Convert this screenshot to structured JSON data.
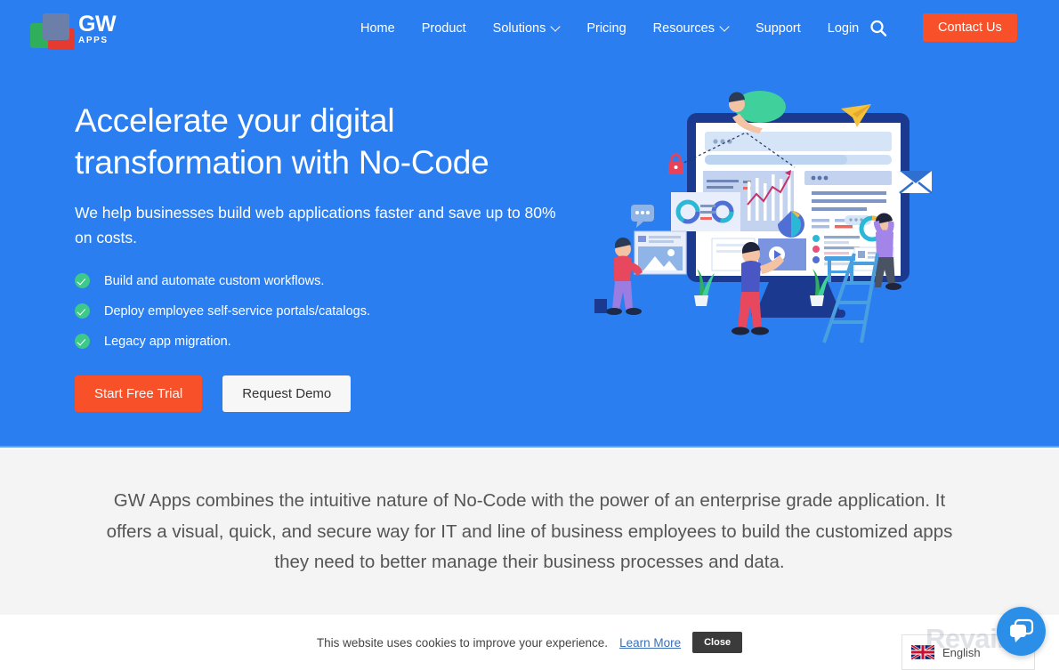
{
  "brand": {
    "logo_name": "GW",
    "logo_sub": "APPS",
    "colors": {
      "hero_blue": "#2b7ef0",
      "accent_orange": "#f8512a",
      "check_green": "#3dc98a",
      "logo_green": "#2fae5c",
      "logo_red": "#e43a30",
      "logo_blue": "#6b7fa8",
      "chat_blue": "#2b8fe8"
    }
  },
  "nav": {
    "items": [
      {
        "label": "Home",
        "has_dropdown": false
      },
      {
        "label": "Product",
        "has_dropdown": false
      },
      {
        "label": "Solutions",
        "has_dropdown": true
      },
      {
        "label": "Pricing",
        "has_dropdown": false
      },
      {
        "label": "Resources",
        "has_dropdown": true
      },
      {
        "label": "Support",
        "has_dropdown": false
      },
      {
        "label": "Login",
        "has_dropdown": false
      }
    ],
    "search_icon": "search-icon",
    "contact_label": "Contact Us"
  },
  "hero": {
    "title_line1": "Accelerate your digital",
    "title_line2": "transformation with No-Code",
    "subtitle": "We help businesses build web applications faster and save up to 80% on costs.",
    "bullets": [
      "Build and automate custom workflows.",
      "Deploy employee self-service portals/catalogs.",
      "Legacy app migration."
    ],
    "cta_primary": "Start Free Trial",
    "cta_secondary": "Request Demo",
    "illustration_name": "team-building-web-dashboard-illustration"
  },
  "info": {
    "paragraph": "GW Apps combines the intuitive nature of No-Code with the power of an enterprise grade application. It offers a visual, quick, and secure way for IT and line of business employees to build the customized apps they need to better manage their business processes and data."
  },
  "cookie": {
    "message": "This website uses cookies to improve your experience.",
    "learn_more": "Learn More",
    "close_label": "Close"
  },
  "language": {
    "selected": "English",
    "flag_icon": "uk-flag-icon"
  },
  "watermark": {
    "text": "Revain"
  },
  "chat": {
    "icon": "chat-bubble-icon"
  }
}
